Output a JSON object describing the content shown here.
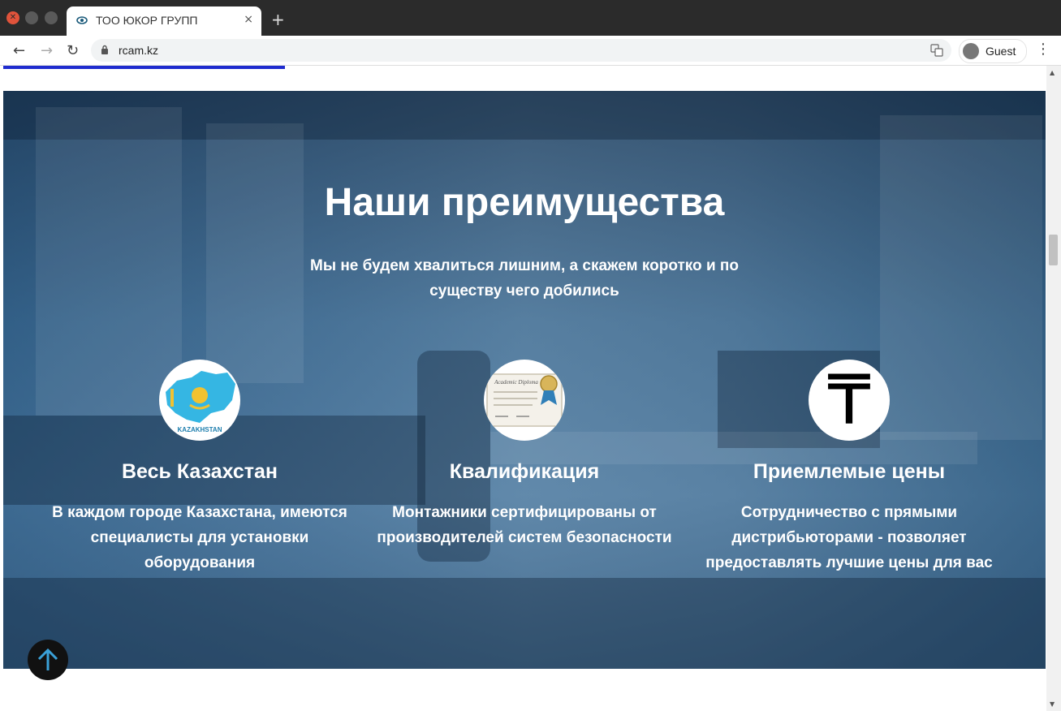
{
  "browser": {
    "tab_title": "ТОО ЮКОР ГРУПП",
    "tab_close": "×",
    "new_tab": "+",
    "url": "rcam.kz",
    "profile_label": "Guest",
    "back": "←",
    "forward": "→",
    "reload": "↻",
    "menu": "⋮"
  },
  "page": {
    "progress_percent": 27,
    "title": "Наши преимущества",
    "subtitle": "Мы не будем хвалиться лишним, а скажем коротко и по существу чего добились",
    "features": [
      {
        "icon": "kazakhstan-map-icon",
        "icon_text": "KAZAKHSTAN",
        "title": "Весь Казахстан",
        "text": "В каждом городе Казахстана, имеются специалисты для установки оборудования"
      },
      {
        "icon": "certificate-icon",
        "icon_text": "Academic Diploma",
        "title": "Квалификация",
        "text": "Монтажники сертифицированы от производителей систем безопасности"
      },
      {
        "icon": "tenge-icon",
        "icon_text": "₸",
        "title": "Приемлемые цены",
        "text": "Сотрудничество с прямыми дистрибьюторами - позволяет предоставлять лучшие цены для вас"
      }
    ],
    "scroll_top_icon": "arrow-up-icon"
  },
  "colors": {
    "progress": "#1f2ccf",
    "kz_blue": "#35b6e3",
    "kz_gold": "#f2c230"
  }
}
